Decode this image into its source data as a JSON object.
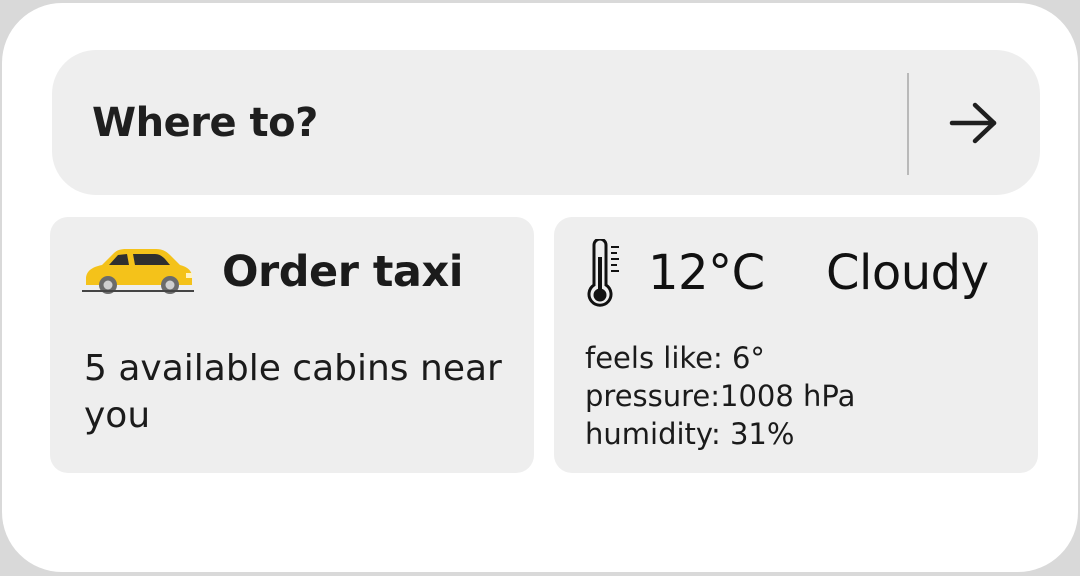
{
  "search": {
    "label": "Where to?",
    "go_icon": "arrow-right-icon"
  },
  "taxi": {
    "icon": "taxi-car-icon",
    "title": "Order taxi",
    "subtitle": "5 available cabins near you",
    "icon_color": "#f2c218"
  },
  "weather": {
    "icon": "thermometer-icon",
    "temperature": "12°C",
    "condition": "Cloudy",
    "feels_like": "feels like: 6°",
    "pressure": "pressure:1008 hPa",
    "humidity": "humidity: 31%"
  }
}
